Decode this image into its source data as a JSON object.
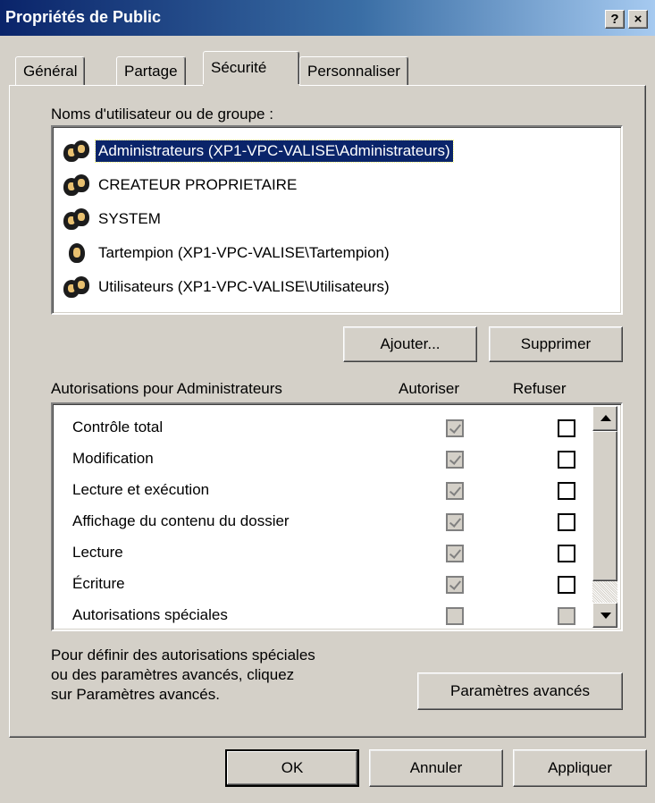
{
  "window": {
    "title": "Propriétés de Public",
    "help_label": "?",
    "close_label": "×"
  },
  "tabs": [
    {
      "label": "Général"
    },
    {
      "label": "Partage"
    },
    {
      "label": "Sécurité"
    },
    {
      "label": "Personnaliser"
    }
  ],
  "users_section": {
    "label": "Noms d'utilisateur ou de groupe :",
    "items": [
      {
        "name": "Administrateurs (XP1-VPC-VALISE\\Administrateurs)",
        "icon": "group-icon",
        "selected": true
      },
      {
        "name": "CREATEUR PROPRIETAIRE",
        "icon": "group-icon"
      },
      {
        "name": "SYSTEM",
        "icon": "group-icon"
      },
      {
        "name": "Tartempion (XP1-VPC-VALISE\\Tartempion)",
        "icon": "user-icon"
      },
      {
        "name": "Utilisateurs (XP1-VPC-VALISE\\Utilisateurs)",
        "icon": "group-icon"
      }
    ],
    "add_button": "Ajouter...",
    "remove_button": "Supprimer"
  },
  "permissions": {
    "label": "Autorisations pour Administrateurs",
    "allow_header": "Autoriser",
    "deny_header": "Refuser",
    "items": [
      {
        "name": "Contrôle total",
        "allow": true,
        "deny": false
      },
      {
        "name": "Modification",
        "allow": true,
        "deny": false
      },
      {
        "name": "Lecture et exécution",
        "allow": true,
        "deny": false
      },
      {
        "name": "Affichage du contenu du dossier",
        "allow": true,
        "deny": false
      },
      {
        "name": "Lecture",
        "allow": true,
        "deny": false
      },
      {
        "name": "Écriture",
        "allow": true,
        "deny": false
      },
      {
        "name": "Autorisations spéciales",
        "allow": false,
        "deny": false
      }
    ]
  },
  "advanced": {
    "hint_line1": "Pour définir des autorisations spéciales",
    "hint_line2": "ou des paramètres avancés, cliquez",
    "hint_line3": "sur Paramètres avancés.",
    "button": "Paramètres avancés"
  },
  "footer": {
    "ok": "OK",
    "cancel": "Annuler",
    "apply": "Appliquer"
  },
  "colors": {
    "titlebar_start": "#0a246a",
    "titlebar_end": "#a6caf0",
    "selection": "#0a246a",
    "face": "#d4d0c8"
  }
}
